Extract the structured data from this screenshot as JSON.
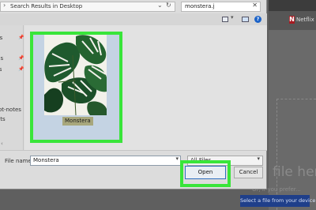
{
  "dialog": {
    "address_path": "Search Results in Desktop",
    "search_value": "monstera.j"
  },
  "nav": {
    "items": [
      {
        "label": "ss",
        "pinned": true
      },
      {
        "label": "ds",
        "pinned": true
      },
      {
        "label": "ts",
        "pinned": true
      },
      {
        "label": "s",
        "pinned": false
      },
      {
        "label": "iot-notes",
        "pinned": false
      },
      {
        "label": "ots",
        "pinned": false
      }
    ]
  },
  "file": {
    "name": "Monstera"
  },
  "footer": {
    "filename_label": "File name:",
    "filename_value": "Monstera",
    "filetype_value": "All Files",
    "open_label": "Open",
    "cancel_label": "Cancel"
  },
  "background": {
    "netflix_label": "Netflix",
    "drop_text": "file here",
    "prefer_text": "Or, if you prefer...",
    "select_button_label": "Select a file from your device"
  },
  "colors": {
    "highlight": "#39e53a",
    "select_button": "#1f3f8a",
    "selection": "#c4d3e3",
    "help_icon": "#1c63c8"
  }
}
